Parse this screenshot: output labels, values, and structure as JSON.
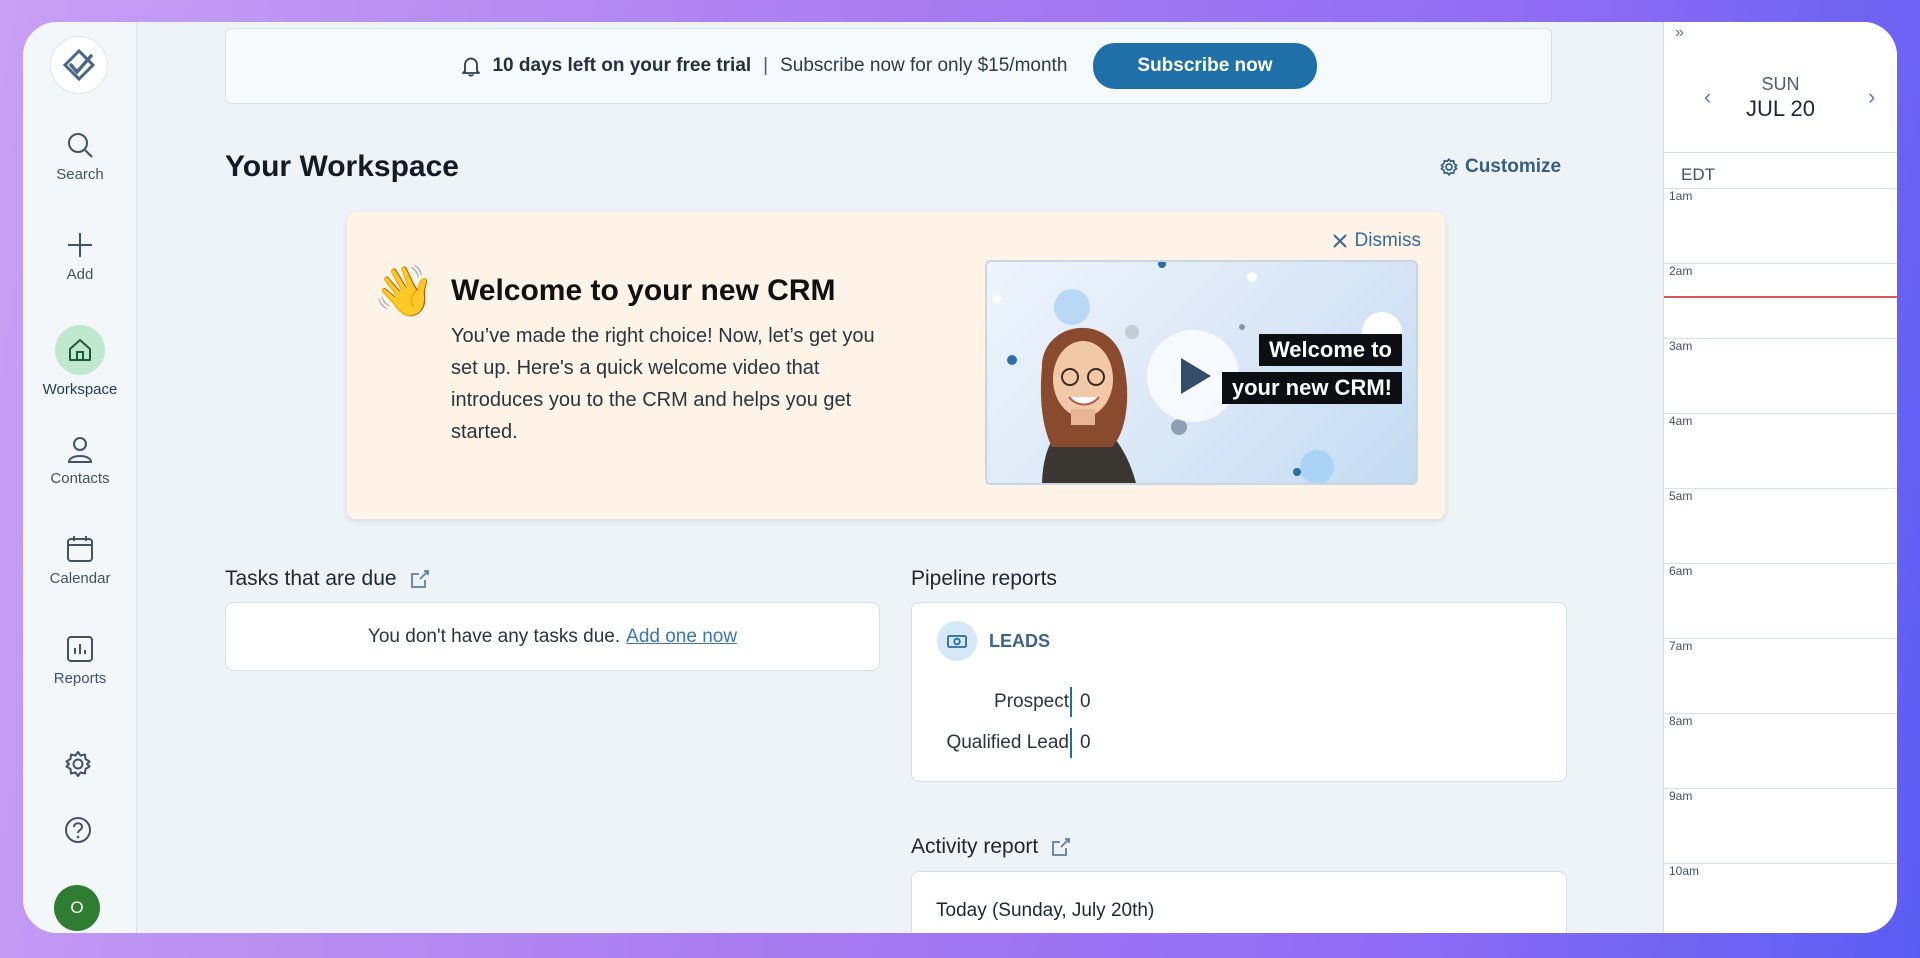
{
  "nav": {
    "items": [
      {
        "label": "Search",
        "icon": "search-icon"
      },
      {
        "label": "Add",
        "icon": "plus-icon"
      },
      {
        "label": "Workspace",
        "icon": "home-icon",
        "active": true
      },
      {
        "label": "Contacts",
        "icon": "person-icon"
      },
      {
        "label": "Calendar",
        "icon": "calendar-icon"
      },
      {
        "label": "Reports",
        "icon": "reports-icon"
      }
    ],
    "avatar_initial": "O"
  },
  "trial": {
    "days_left": "10 days left on your free trial",
    "separator": "|",
    "offer": "Subscribe now for only $15/month",
    "button": "Subscribe now"
  },
  "workspace": {
    "title": "Your Workspace",
    "customize": "Customize"
  },
  "welcome": {
    "emoji": "👋",
    "title": "Welcome to your new CRM",
    "body": "You’ve made the right choice! Now, let’s get you set up. Here's a quick welcome video that introduces you to the CRM and helps you get started.",
    "dismiss": "Dismiss",
    "video_caption_line1": "Welcome to",
    "video_caption_line2": "your new CRM!"
  },
  "tasks": {
    "title": "Tasks that are due",
    "empty_text": "You don't have any tasks due.",
    "add_link": "Add one now"
  },
  "pipeline": {
    "title": "Pipeline reports",
    "group": "LEADS",
    "rows": [
      {
        "label": "Prospect",
        "value": "0"
      },
      {
        "label": "Qualified Lead",
        "value": "0"
      }
    ]
  },
  "activity": {
    "title": "Activity report",
    "today": "Today (Sunday, July 20th)"
  },
  "calendar": {
    "expand": "»",
    "day": "SUN",
    "date": "JUL 20",
    "timezone": "EDT",
    "hours": [
      "1am",
      "2am",
      "3am",
      "4am",
      "5am",
      "6am",
      "7am",
      "8am",
      "9am",
      "10am"
    ]
  },
  "colors": {
    "accent": "#1f6fa8",
    "active_nav": "#bfe8cc",
    "now_line": "#e25555",
    "welcome_bg": "#fdf3e6"
  }
}
